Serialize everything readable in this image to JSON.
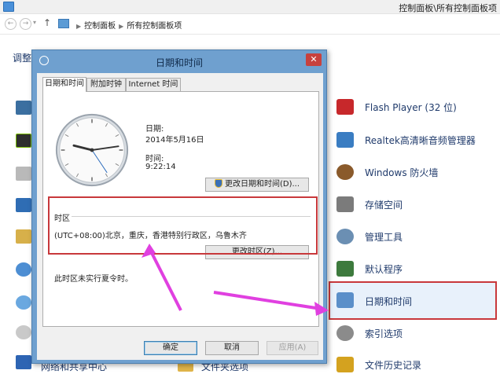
{
  "window": {
    "title": "控制面板\\所有控制面板项"
  },
  "addressbar": {
    "back": "←",
    "forward": "→",
    "up": "↑",
    "path": [
      "控制面板",
      "所有控制面板项"
    ]
  },
  "heading_clipped": "调整",
  "right_items": [
    {
      "label": "Flash Player (32 位)",
      "icon": "flash-player-icon",
      "color": "#c7282b"
    },
    {
      "label": "Realtek高清晰音频管理器",
      "icon": "realtek-audio-icon",
      "color": "#3a7dc2"
    },
    {
      "label": "Windows 防火墙",
      "icon": "firewall-icon",
      "color": "#8a5a2b"
    },
    {
      "label": "存储空间",
      "icon": "storage-spaces-icon",
      "color": "#7b7b7b"
    },
    {
      "label": "管理工具",
      "icon": "admin-tools-icon",
      "color": "#6b8fb3"
    },
    {
      "label": "默认程序",
      "icon": "default-programs-icon",
      "color": "#3d7a3d"
    },
    {
      "label": "日期和时间",
      "icon": "date-time-icon",
      "color": "#5b8fc9",
      "selected": true
    },
    {
      "label": "索引选项",
      "icon": "indexing-icon",
      "color": "#8b8b8b"
    },
    {
      "label": "文件历史记录",
      "icon": "file-history-icon",
      "color": "#d4a21f"
    }
  ],
  "bottom_clipped": {
    "left": "网络和共享中心",
    "mid": "文件夹选项"
  },
  "dialog": {
    "title": "日期和时间",
    "close": "✕",
    "tabs": [
      "日期和时间",
      "附加时钟",
      "Internet 时间"
    ],
    "date_label": "日期:",
    "date_value": "2014年5月16日",
    "time_label": "时间:",
    "time_value": "9:22:14",
    "change_datetime_button": "更改日期和时间(D)...",
    "timezone_group": "时区",
    "timezone_value": "(UTC+08:00)北京，重庆，香港特别行政区，乌鲁木齐",
    "change_timezone_button": "更改时区(Z)...",
    "dst_note": "此时区未实行夏令时。",
    "ok": "确定",
    "cancel": "取消",
    "apply": "应用(A)"
  },
  "colors": {
    "highlight_border": "#c8383b",
    "arrow": "#e040e0",
    "dialog_frame": "#6fa0cf"
  }
}
